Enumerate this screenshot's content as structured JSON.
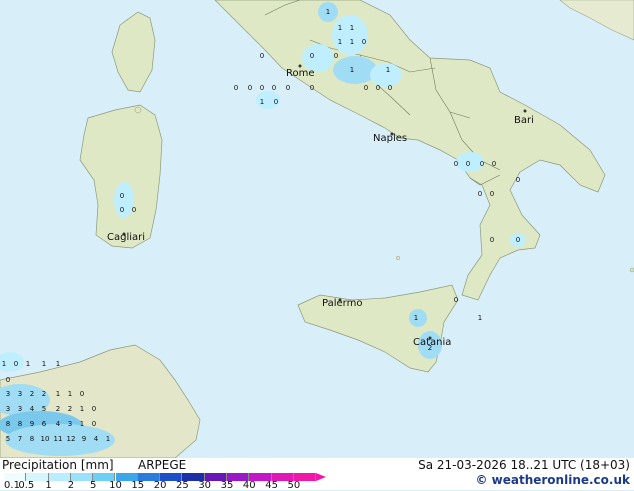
{
  "map": {
    "cities": [
      {
        "name": "Rome"
      },
      {
        "name": "Naples"
      },
      {
        "name": "Bari"
      },
      {
        "name": "Cagliari"
      },
      {
        "name": "Palermo"
      },
      {
        "name": "Catania"
      }
    ],
    "values": [
      "1",
      "1",
      "1",
      "1",
      "1",
      "1",
      "1",
      "0",
      "0",
      "0",
      "0",
      "0",
      "0",
      "0",
      "0",
      "0",
      "0",
      "1",
      "0",
      "0",
      "0",
      "0",
      "0",
      "0",
      "0",
      "0",
      "0",
      "0",
      "0",
      "0",
      "0",
      "0",
      "0",
      "0",
      "0",
      "1",
      "2",
      "1",
      "1",
      "0",
      "1",
      "1",
      "1",
      "0",
      "3",
      "3",
      "2",
      "2",
      "1",
      "1",
      "0",
      "3",
      "3",
      "4",
      "5",
      "2",
      "2",
      "1",
      "0",
      "8",
      "8",
      "9",
      "6",
      "4",
      "3",
      "1",
      "0",
      "5",
      "7",
      "8",
      "10",
      "11",
      "12",
      "9",
      "4",
      "1"
    ],
    "colors": {
      "sea": "#d8eef8",
      "land": "#dfe8c4",
      "precip_light": "#bfefff",
      "precip_mid": "#a0dcf4",
      "precip_heavy": "#7ac8ec"
    }
  },
  "footer": {
    "title": "Precipitation [mm]",
    "model": "ARPEGE",
    "datetime": "Sa 21-03-2026 18..21 UTC (18+03)",
    "credit": "© weatheronline.co.uk",
    "legend_ticks": [
      "0.1",
      "0.5",
      "1",
      "2",
      "5",
      "10",
      "15",
      "20",
      "25",
      "30",
      "35",
      "40",
      "45",
      "50"
    ],
    "legend_colors": [
      "#f0fdff",
      "#d4f6ff",
      "#b8eeff",
      "#98e2fb",
      "#6cd0f4",
      "#3aa8e8",
      "#2a7cdc",
      "#1f4fc8",
      "#1d2fa8",
      "#6818b8",
      "#9a18c8",
      "#c418c8",
      "#e018b8",
      "#f018a8"
    ]
  }
}
